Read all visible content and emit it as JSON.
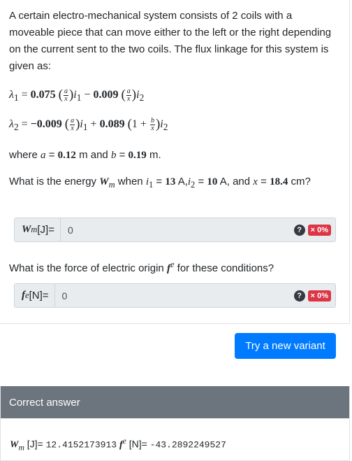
{
  "question": {
    "intro": "A certain electro-mechanical system consists of 2 coils with a moveable piece that can move either to the left or the right depending on the current sent to the two coils. The flux linkage for this system is given as:",
    "eq1": {
      "lhs": "λ",
      "sub": "1",
      "c1": "0.075",
      "c2": "0.009"
    },
    "eq2": {
      "lhs": "λ",
      "sub": "2",
      "c1": "−0.009",
      "c2": "0.089"
    },
    "where": {
      "pre": "where",
      "a_val": "0.12",
      "unit_a": "m and",
      "b_val": "0.19",
      "unit_b": "m."
    },
    "q1": {
      "pre": "What is the energy",
      "mid": "when",
      "i1": "13",
      "i2": "10",
      "x": "18.4",
      "unit_i": "A,",
      "unit_i2": "A, and",
      "unit_x": "cm?"
    },
    "q2": {
      "text": "What is the force of electric origin",
      "post": "for these conditions?"
    }
  },
  "inputs": {
    "wm": {
      "label_unit": "[J]=",
      "value": "0",
      "score": "× 0%"
    },
    "fe": {
      "label_unit": "[N]=",
      "value": "0",
      "score": "× 0%"
    }
  },
  "help_icon": "?",
  "variant_button": "Try a new variant",
  "answer": {
    "header": "Correct answer",
    "wm_unit": "[J]=",
    "wm_value": "12.4152173913",
    "fe_unit": "[N]=",
    "fe_value": "-43.2892249527"
  },
  "colors": {
    "primary": "#007bff",
    "danger": "#dc3545",
    "header_gray": "#6c757d"
  }
}
